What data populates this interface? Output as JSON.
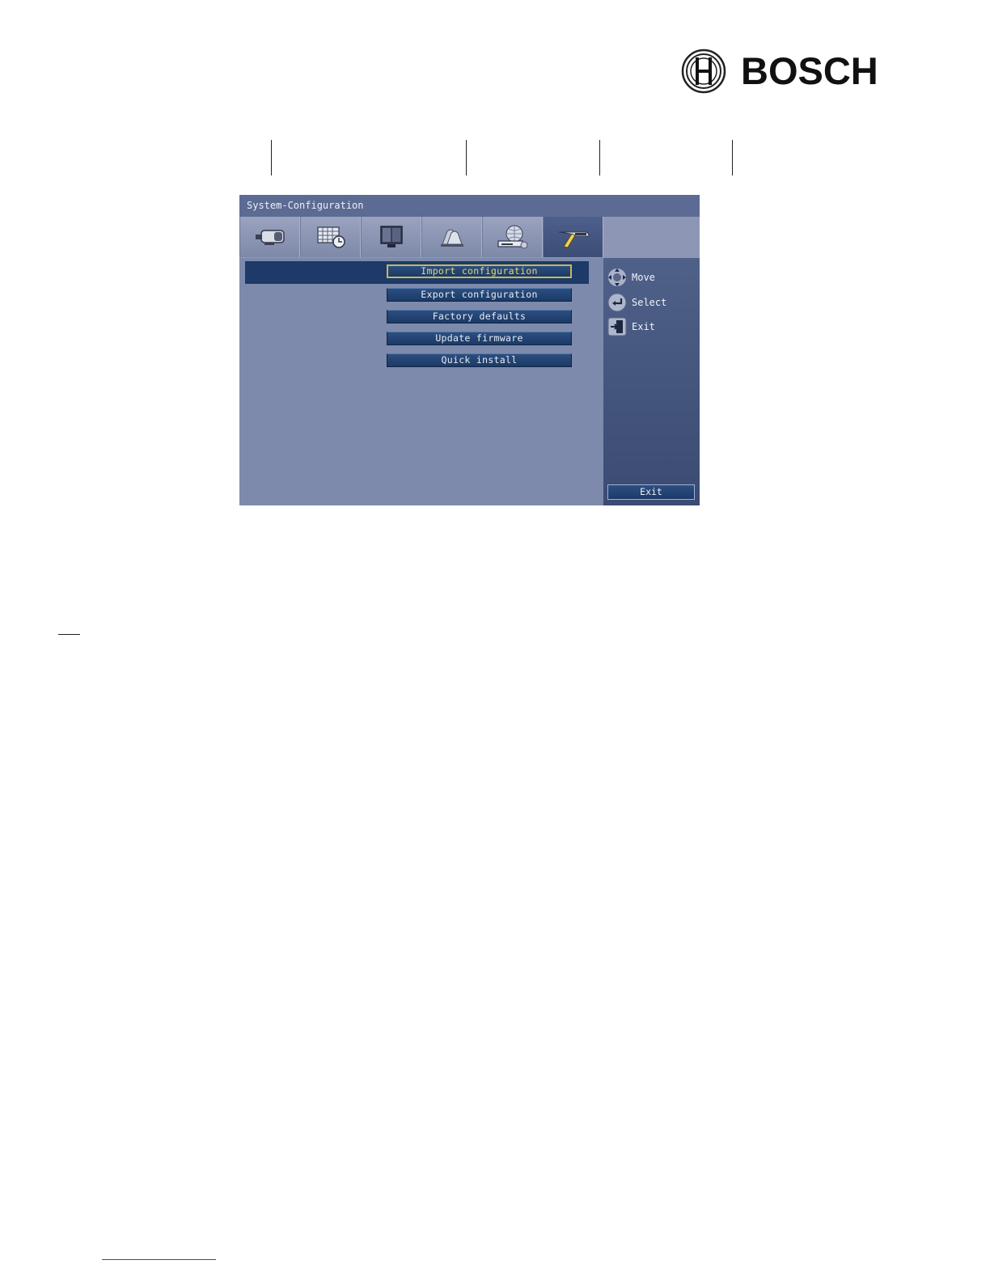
{
  "brand": {
    "name": "BOSCH"
  },
  "window": {
    "title": "System-Configuration"
  },
  "tabs": [
    {
      "icon": "camera-icon"
    },
    {
      "icon": "schedule-icon"
    },
    {
      "icon": "monitor-icon"
    },
    {
      "icon": "alarm-icon"
    },
    {
      "icon": "network-icon"
    },
    {
      "icon": "tools-icon",
      "active": true
    }
  ],
  "menu": {
    "items": [
      {
        "label": "Import configuration",
        "selected": true
      },
      {
        "label": "Export configuration"
      },
      {
        "label": "Factory defaults"
      },
      {
        "label": "Update firmware"
      },
      {
        "label": "Quick install"
      }
    ]
  },
  "hints": {
    "move": {
      "icon": "navigate-arrows-icon",
      "label": "Move"
    },
    "select": {
      "icon": "enter-icon",
      "label": "Select"
    },
    "exit": {
      "icon": "exit-door-icon",
      "label": "Exit"
    }
  },
  "exit_button": {
    "label": "Exit"
  },
  "colors": {
    "window_bg": "#7d8aab",
    "title_bar": "#5b6b93",
    "selected_row": "#1d3a68",
    "selected_border": "#c7b75a",
    "side_pane": "#3b4b72"
  }
}
